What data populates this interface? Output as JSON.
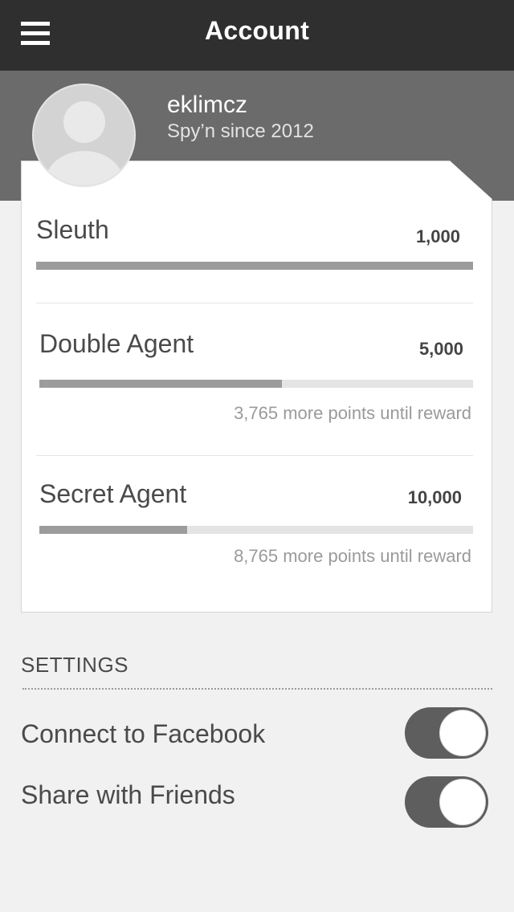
{
  "header": {
    "title": "Account",
    "menu_icon": "hamburger-menu-icon"
  },
  "profile": {
    "username": "eklimcz",
    "member_since": "Spy’n since 2012",
    "avatar_icon": "user-avatar-icon"
  },
  "levels": [
    {
      "name": "Sleuth",
      "points": "1,000",
      "progress": 1.0,
      "remaining": ""
    },
    {
      "name": "Double Agent",
      "points": "5,000",
      "progress": 0.56,
      "remaining": "3,765 more points until reward"
    },
    {
      "name": "Secret Agent",
      "points": "10,000",
      "progress": 0.34,
      "remaining": "8,765 more points until reward"
    }
  ],
  "settings": {
    "title": "SETTINGS",
    "items": [
      {
        "label": "Connect to Facebook",
        "enabled": true
      },
      {
        "label": "Share with Friends",
        "enabled": true
      }
    ]
  },
  "colors": {
    "navbar": "#2f2f2f",
    "profile_band": "#6b6b6b",
    "progress_fill": "#9c9c9c",
    "progress_track": "#e4e4e4",
    "toggle_on": "#5e5e5e"
  }
}
